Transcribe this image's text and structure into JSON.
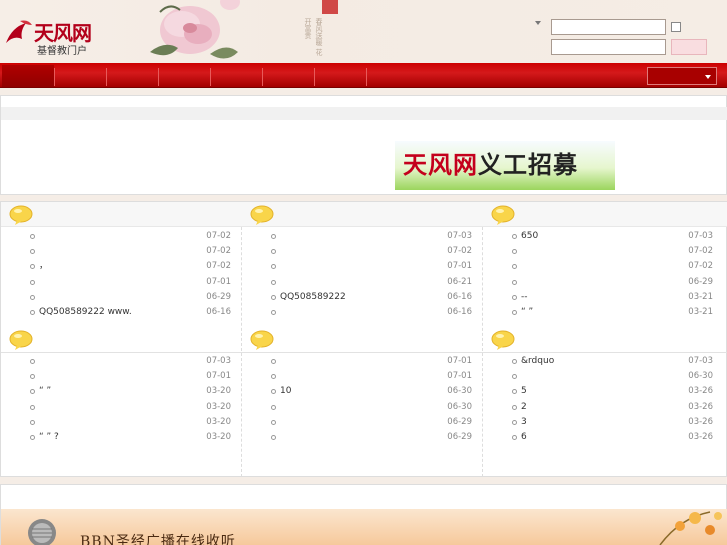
{
  "site": {
    "logo_text": "天风网",
    "logo_sub": "基督教门户",
    "calligraphy": "春风送暖 花开富贵"
  },
  "nav": {
    "item_count": 7
  },
  "banner": {
    "text_red": "天风网",
    "text_black": "义工招募"
  },
  "columns": [
    {
      "items": [
        {
          "title": "",
          "date": "07-02"
        },
        {
          "title": "",
          "date": "07-02"
        },
        {
          "title": "，",
          "date": "07-02"
        },
        {
          "title": "",
          "date": "07-01"
        },
        {
          "title": "",
          "date": "06-29"
        },
        {
          "title": "QQ508589222 www.",
          "date": "06-16"
        }
      ]
    },
    {
      "items": [
        {
          "title": "",
          "date": "07-03"
        },
        {
          "title": "",
          "date": "07-02"
        },
        {
          "title": "",
          "date": "07-01"
        },
        {
          "title": "",
          "date": "06-21"
        },
        {
          "title": "QQ508589222",
          "date": "06-16"
        },
        {
          "title": "",
          "date": "06-16"
        }
      ]
    },
    {
      "items": [
        {
          "title": "650",
          "date": "07-03"
        },
        {
          "title": "",
          "date": "07-02"
        },
        {
          "title": "",
          "date": "07-02"
        },
        {
          "title": "",
          "date": "06-29"
        },
        {
          "title": "--",
          "date": "03-21"
        },
        {
          "title": "“ ”",
          "date": "03-21"
        }
      ]
    },
    {
      "items": [
        {
          "title": "",
          "date": "07-03"
        },
        {
          "title": "",
          "date": "07-01"
        },
        {
          "title": "“ ”",
          "date": "03-20"
        },
        {
          "title": "",
          "date": "03-20"
        },
        {
          "title": "",
          "date": "03-20"
        },
        {
          "title": "“ ” ?",
          "date": "03-20"
        }
      ]
    },
    {
      "items": [
        {
          "title": "",
          "date": "07-01"
        },
        {
          "title": "",
          "date": "07-01"
        },
        {
          "title": "10",
          "date": "06-30"
        },
        {
          "title": "",
          "date": "06-30"
        },
        {
          "title": "",
          "date": "06-29"
        },
        {
          "title": "",
          "date": "06-29"
        }
      ]
    },
    {
      "items": [
        {
          "title": "&rdquo",
          "date": "07-03"
        },
        {
          "title": "",
          "date": "06-30"
        },
        {
          "title": "5",
          "date": "03-26"
        },
        {
          "title": "2",
          "date": "03-26"
        },
        {
          "title": "3",
          "date": "03-26"
        },
        {
          "title": "6",
          "date": "03-26"
        }
      ]
    }
  ],
  "radio": {
    "title": "BBN圣经广播在线收听"
  },
  "colors": {
    "nav_red": "#c00000",
    "brand_red": "#b3001b"
  },
  "icons": [
    "peony-flower",
    "logo-swirl",
    "speech-bubble-icon",
    "microphone-icon"
  ]
}
